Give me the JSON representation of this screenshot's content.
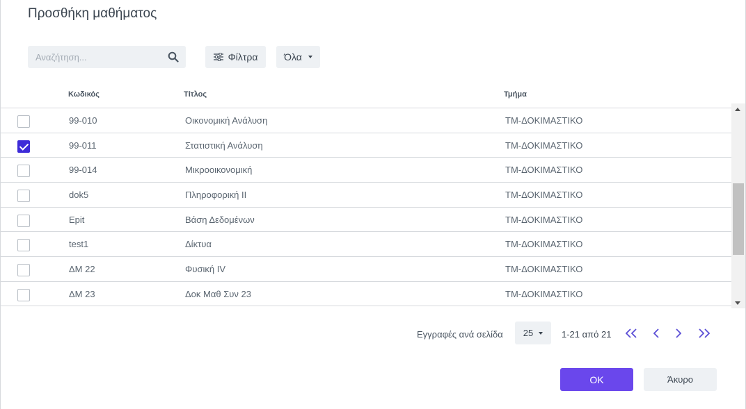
{
  "dialog": {
    "title": "Προσθήκη μαθήματος"
  },
  "toolbar": {
    "search_placeholder": "Αναζήτηση...",
    "filters_label": "Φίλτρα",
    "all_label": "Όλα"
  },
  "table": {
    "headers": {
      "code": "Κωδικός",
      "title": "Τίτλος",
      "dept": "Τμήμα"
    },
    "rows": [
      {
        "checked": false,
        "code": "99-010",
        "title": "Οικονομική Ανάλυση",
        "dept": "ΤΜ-ΔΟΚΙΜΑΣΤΙΚΟ"
      },
      {
        "checked": true,
        "code": "99-011",
        "title": "Στατιστική Ανάλυση",
        "dept": "ΤΜ-ΔΟΚΙΜΑΣΤΙΚΟ"
      },
      {
        "checked": false,
        "code": "99-014",
        "title": "Μικροοικονομική",
        "dept": "ΤΜ-ΔΟΚΙΜΑΣΤΙΚΟ"
      },
      {
        "checked": false,
        "code": "dok5",
        "title": "Πληροφορική ΙΙ",
        "dept": "ΤΜ-ΔΟΚΙΜΑΣΤΙΚΟ"
      },
      {
        "checked": false,
        "code": "Epit",
        "title": "Βάση Δεδομένων",
        "dept": "ΤΜ-ΔΟΚΙΜΑΣΤΙΚΟ"
      },
      {
        "checked": false,
        "code": "test1",
        "title": "Δίκτυα",
        "dept": "ΤΜ-ΔΟΚΙΜΑΣΤΙΚΟ"
      },
      {
        "checked": false,
        "code": "ΔΜ 22",
        "title": "Φυσική IV",
        "dept": "ΤΜ-ΔΟΚΙΜΑΣΤΙΚΟ"
      },
      {
        "checked": false,
        "code": "ΔΜ 23",
        "title": "Δοκ Μαθ Συν 23",
        "dept": "ΤΜ-ΔΟΚΙΜΑΣΤΙΚΟ"
      }
    ]
  },
  "pager": {
    "per_page_label": "Εγγραφές ανά σελίδα",
    "per_page_value": "25",
    "range_text": "1-21 από 21"
  },
  "actions": {
    "ok_label": "OK",
    "cancel_label": "Άκυρο"
  },
  "colors": {
    "accent": "#6a47ec",
    "checkbox": "#3d2bd8",
    "pager_icon": "#5b4fd6"
  }
}
